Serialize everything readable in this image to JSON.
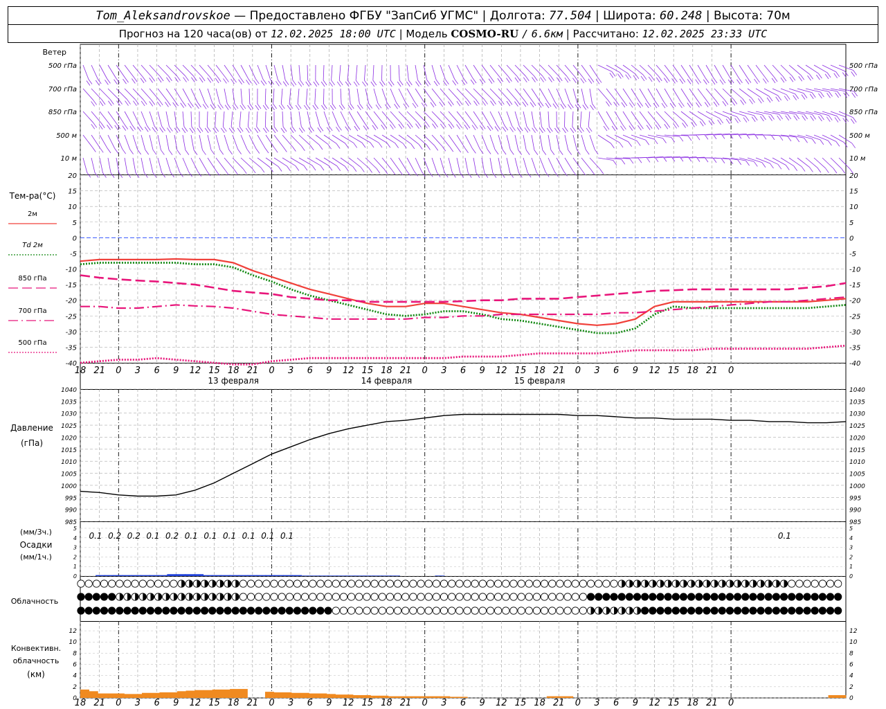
{
  "header": {
    "station": "Tom_Aleksandrovskoe",
    "dash": "—",
    "provider": "Предоставлено ФГБУ \"ЗапСиб УГМС\"",
    "sep": "|",
    "lon_label": "Долгота:",
    "lon_value": "77.504",
    "lat_label": "Широта:",
    "lat_value": "60.248",
    "alt_label": "Высота:",
    "alt_value": "70м",
    "forecast_label": "Прогноз на 120 часа(ов)",
    "from_label": "от",
    "forecast_start": "12.02.2025 18:00 UTC",
    "model_label": "Модель",
    "model_name": "COSMO-RU",
    "model_res_sep": "/",
    "model_res": "6.6км",
    "calc_label": "Рассчитано:",
    "calc_time": "12.02.2025 23:33 UTC"
  },
  "colors": {
    "t2m": "#f0403a",
    "td2m": "#118811",
    "t850": "#e8157a",
    "t700": "#e8157a",
    "t500": "#e8157a",
    "wind": "#8a2be2",
    "zero_line": "#3355ff",
    "pressure": "#000000",
    "precip": "#2244dd",
    "convective": "#f08a20"
  },
  "time_axis": {
    "ticks": [
      "18",
      "21",
      "0",
      "3",
      "6",
      "9",
      "12",
      "15",
      "18",
      "21",
      "0",
      "3",
      "6",
      "9",
      "12",
      "15",
      "18",
      "21",
      "0",
      "3",
      "6",
      "9",
      "12",
      "15",
      "18",
      "21",
      "0",
      "3",
      "6",
      "9",
      "12",
      "15",
      "18",
      "21",
      "0"
    ],
    "date_labels": [
      "13 февраля",
      "14 февраля",
      "15 февраля"
    ]
  },
  "wind_panel": {
    "title": "Ветер",
    "levels": [
      "500 гПа",
      "700 гПа",
      "850 гПа",
      "500 м",
      "10  м"
    ]
  },
  "icons": {
    "wind_barb": "wind-barb-icon",
    "cloud_clear": "circle-empty-icon",
    "cloud_partial": "circle-half-icon",
    "cloud_overcast": "circle-filled-icon"
  },
  "cloud_panel": {
    "title": "Облачность"
  },
  "chart_data": [
    {
      "type": "line",
      "title": "Тем-ра(°C)",
      "ylim": [
        -40,
        20
      ],
      "yticks": [
        "20",
        "15",
        "10",
        "5",
        "0",
        "-5",
        "-10",
        "-15",
        "-20",
        "-25",
        "-30",
        "-35",
        "-40"
      ],
      "x_hours": [
        0,
        3,
        6,
        9,
        12,
        15,
        18,
        21,
        24,
        27,
        30,
        33,
        36,
        39,
        42,
        45,
        48,
        51,
        54,
        57,
        60,
        63,
        66,
        69,
        72,
        75,
        78,
        81,
        84,
        87,
        90,
        93,
        96,
        99,
        102,
        105,
        108,
        111,
        114,
        117,
        120
      ],
      "series": [
        {
          "name": "2м",
          "style": "solid",
          "values": [
            -7.5,
            -7,
            -7,
            -7,
            -7,
            -6.8,
            -7,
            -7,
            -8,
            -10.5,
            -12.5,
            -14.5,
            -16.5,
            -18,
            -19.5,
            -21,
            -22,
            -22,
            -21,
            -21,
            -22,
            -23,
            -24,
            -24.5,
            -25.5,
            -26.5,
            -27.5,
            -28,
            -27.5,
            -26,
            -22,
            -20.5,
            -20.5,
            -20.5,
            -20.5,
            -20.5,
            -20.5,
            -20.5,
            -20.5,
            -20,
            -19.5
          ]
        },
        {
          "name": "Td 2м",
          "style": "dotted",
          "values": [
            -8.5,
            -8,
            -8,
            -8,
            -8,
            -8,
            -8.5,
            -8.5,
            -9.5,
            -12,
            -14,
            -16.5,
            -18.5,
            -20,
            -21.5,
            -23,
            -24.5,
            -25,
            -24.5,
            -23.5,
            -23.5,
            -24.5,
            -26,
            -26.5,
            -27.5,
            -28.5,
            -29.5,
            -30.5,
            -30.5,
            -29,
            -24.5,
            -22,
            -22.5,
            -22.5,
            -22.5,
            -22.5,
            -22.5,
            -22.5,
            -22.5,
            -22,
            -21.5
          ]
        },
        {
          "name": "850 гПа",
          "style": "dashed",
          "values": [
            -12,
            -12.8,
            -13.3,
            -13.7,
            -14,
            -14.5,
            -15,
            -16,
            -17,
            -17.5,
            -18,
            -19,
            -19.5,
            -20,
            -20,
            -20.5,
            -20.5,
            -20.5,
            -20.5,
            -20.5,
            -20.3,
            -20,
            -20,
            -19.5,
            -19.5,
            -19.5,
            -19,
            -18.5,
            -18,
            -17.5,
            -17,
            -16.8,
            -16.5,
            -16.5,
            -16.5,
            -16.5,
            -16.5,
            -16.5,
            -16,
            -15.5,
            -14.5
          ]
        },
        {
          "name": "700 гПа",
          "style": "dashdot",
          "values": [
            -22,
            -22,
            -22.5,
            -22.5,
            -22,
            -21.5,
            -21.8,
            -22,
            -22.5,
            -23.5,
            -24.5,
            -25,
            -25.5,
            -26,
            -26,
            -26,
            -26,
            -26,
            -25.5,
            -25.5,
            -25,
            -25,
            -24.5,
            -24.5,
            -24.5,
            -24.5,
            -24.5,
            -24.5,
            -24,
            -24,
            -23.5,
            -23,
            -22.5,
            -22,
            -21.5,
            -21,
            -20.5,
            -20.5,
            -20,
            -19.5,
            -19
          ]
        },
        {
          "name": "500 гПа",
          "style": "dotted",
          "values": [
            -40,
            -39.5,
            -39,
            -39,
            -38.5,
            -39,
            -39.5,
            -40,
            -40.5,
            -40.5,
            -39.5,
            -39,
            -38.5,
            -38.5,
            -38.5,
            -38.5,
            -38.5,
            -38.5,
            -38.5,
            -38.5,
            -38,
            -38,
            -38,
            -37.5,
            -37,
            -37,
            -37,
            -37,
            -36.5,
            -36,
            -36,
            -36,
            -36,
            -35.5,
            -35.5,
            -35.5,
            -35.5,
            -35.5,
            -35.5,
            -35,
            -34.5
          ]
        }
      ]
    },
    {
      "type": "line",
      "title": "Давление",
      "ylabel": "(гПа)",
      "ylim": [
        985,
        1040
      ],
      "yticks": [
        "1040",
        "1035",
        "1030",
        "1025",
        "1020",
        "1015",
        "1010",
        "1005",
        "1000",
        "995",
        "990",
        "985"
      ],
      "x_hours": [
        0,
        6,
        12,
        18,
        24,
        30,
        36,
        42,
        48,
        54,
        60,
        66,
        72,
        78,
        84,
        90,
        96,
        102,
        108,
        114,
        120
      ],
      "series": [
        {
          "name": "",
          "values": [
            997.5,
            997,
            996,
            995.5,
            995.5,
            996,
            998,
            1001,
            1005,
            1009,
            1013,
            1016,
            1019,
            1021.5,
            1023.5,
            1025,
            1026.5,
            1027,
            1028,
            1029,
            1029.5
          ]
        }
      ],
      "extra_hours": [
        126,
        132,
        138,
        144,
        150,
        156,
        162,
        168,
        174,
        180,
        186,
        192,
        198,
        204,
        210,
        216,
        222,
        228,
        234,
        240
      ],
      "extra_values": [
        1029.5,
        1029.5,
        1029.5,
        1029.5,
        1029.5,
        1029,
        1029,
        1028.5,
        1028,
        1028,
        1027.5,
        1027.5,
        1027.5,
        1027,
        1027,
        1026.5,
        1026.5,
        1026,
        1026,
        1026.5
      ]
    },
    {
      "type": "bar",
      "title": "Осадки",
      "ylabel_left": "(мм/3ч.)",
      "ylabel_right": "(мм/1ч.)",
      "ylim": [
        0,
        5
      ],
      "yticks": [
        "5",
        "4",
        "3",
        "2",
        "1",
        "0"
      ],
      "labels": [
        {
          "hour": 6,
          "text": "0.1"
        },
        {
          "hour": 9,
          "text": "0.2"
        },
        {
          "hour": 12,
          "text": "0.2"
        },
        {
          "hour": 15,
          "text": "0.1"
        },
        {
          "hour": 18,
          "text": "0.2"
        },
        {
          "hour": 21,
          "text": "0.1"
        },
        {
          "hour": 24,
          "text": "0.1"
        },
        {
          "hour": 27,
          "text": "0.1"
        },
        {
          "hour": 30,
          "text": "0.1"
        },
        {
          "hour": 33,
          "text": "0.1"
        },
        {
          "hour": 36,
          "text": "0.1"
        },
        {
          "hour": 114,
          "text": "0.1"
        }
      ],
      "values_hourly": [
        0,
        0.1,
        0.1,
        0.1,
        0.1,
        0.1,
        0.1,
        0.1,
        0.1,
        0.2,
        0.2,
        0.2,
        0.2,
        0.1,
        0.1,
        0.1,
        0.1,
        0.1,
        0.1,
        0.1,
        0.1,
        0.1,
        0.1,
        0.1,
        0.05,
        0.05,
        0.05,
        0.05,
        0.05,
        0.05,
        0.05,
        0.05,
        0.05,
        0.05,
        0.05,
        0,
        0,
        0,
        0,
        0.05
      ]
    },
    {
      "type": "bar",
      "title": "Конвективн. облачность",
      "ylabel": "(км)",
      "ylim": [
        0,
        13
      ],
      "yticks": [
        "12",
        "10",
        "8",
        "6",
        "4",
        "2",
        "0"
      ],
      "values": [
        1.5,
        1.2,
        0.8,
        0.8,
        0.8,
        0.7,
        0.7,
        0.9,
        0.9,
        1.0,
        1.0,
        1.2,
        1.3,
        1.4,
        1.4,
        1.5,
        1.5,
        1.6,
        1.6,
        0,
        0,
        1.1,
        1.0,
        1.0,
        0.9,
        0.9,
        0.8,
        0.8,
        0.7,
        0.6,
        0.6,
        0.5,
        0.5,
        0.4,
        0.4,
        0.3,
        0.3,
        0.3,
        0.3,
        0.3,
        0.3,
        0.3,
        0.2,
        0.2,
        0,
        0,
        0,
        0,
        0,
        0,
        0,
        0,
        0,
        0.3,
        0.3,
        0.3,
        0,
        0,
        0,
        0,
        0,
        0,
        0,
        0,
        0,
        0,
        0,
        0,
        0,
        0,
        0,
        0,
        0,
        0,
        0,
        0,
        0,
        0,
        0,
        0,
        0,
        0,
        0,
        0,
        0,
        0.5,
        0.5
      ]
    }
  ]
}
